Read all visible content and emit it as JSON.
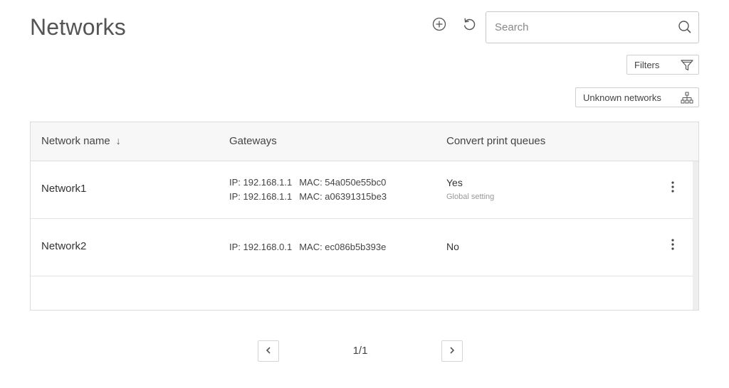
{
  "page": {
    "title": "Networks"
  },
  "toolbar": {
    "add_icon": "plus-circle-icon",
    "refresh_icon": "refresh-icon",
    "search_placeholder": "Search",
    "search_value": "",
    "search_icon": "search-icon",
    "filters_label": "Filters",
    "filters_icon": "funnel-icon",
    "unknown_networks_label": "Unknown networks",
    "unknown_networks_icon": "sitemap-icon"
  },
  "table": {
    "columns": {
      "name": "Network name",
      "name_sort_arrow": "↓",
      "gateways": "Gateways",
      "convert": "Convert print queues"
    },
    "rows": [
      {
        "name": "Network1",
        "gateways": [
          {
            "ip": "IP: 192.168.1.1",
            "mac": "MAC: 54a050e55bc0"
          },
          {
            "ip": "IP: 192.168.1.1",
            "mac": "MAC: a06391315be3"
          }
        ],
        "convert": "Yes",
        "convert_note": "Global setting"
      },
      {
        "name": "Network2",
        "gateways": [
          {
            "ip": "IP: 192.168.0.1",
            "mac": "MAC: ec086b5b393e"
          }
        ],
        "convert": "No",
        "convert_note": ""
      }
    ]
  },
  "pagination": {
    "indicator": "1/1"
  },
  "colors": {
    "border": "#dcdcdc",
    "header_bg": "#f7f7f7",
    "text": "#333333",
    "muted": "#999999"
  }
}
